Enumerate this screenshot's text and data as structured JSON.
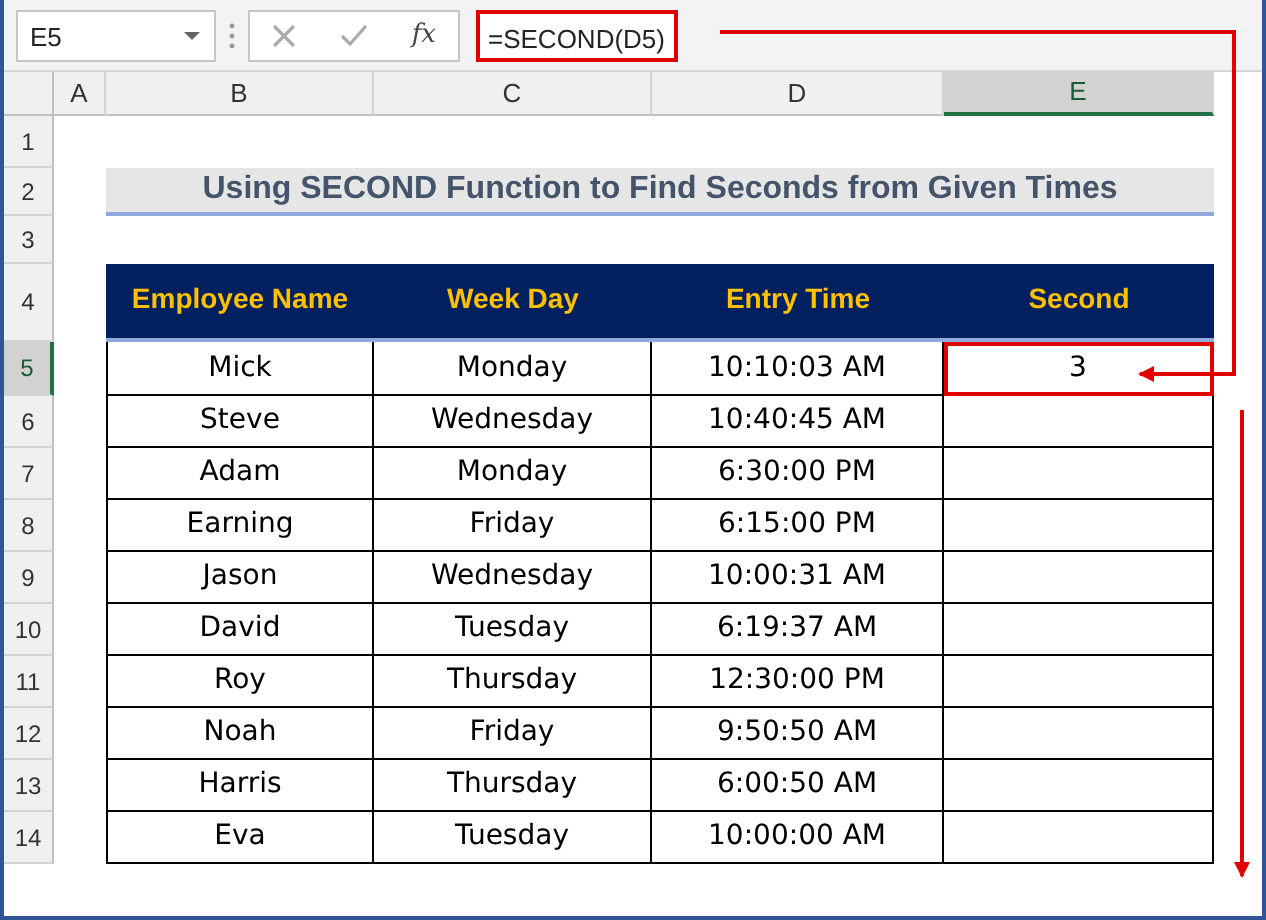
{
  "formula_bar": {
    "name_box": "E5",
    "fx": "fx",
    "formula": "=SECOND(D5)"
  },
  "column_headers": [
    {
      "label": "A",
      "selected": false
    },
    {
      "label": "B",
      "selected": false
    },
    {
      "label": "C",
      "selected": false
    },
    {
      "label": "D",
      "selected": false
    },
    {
      "label": "E",
      "selected": true
    }
  ],
  "row_headers": [
    {
      "label": "1",
      "selected": false
    },
    {
      "label": "2",
      "selected": false
    },
    {
      "label": "3",
      "selected": false
    },
    {
      "label": "4",
      "selected": false
    },
    {
      "label": "5",
      "selected": true
    },
    {
      "label": "6",
      "selected": false
    },
    {
      "label": "7",
      "selected": false
    },
    {
      "label": "8",
      "selected": false
    },
    {
      "label": "9",
      "selected": false
    },
    {
      "label": "10",
      "selected": false
    },
    {
      "label": "11",
      "selected": false
    },
    {
      "label": "12",
      "selected": false
    },
    {
      "label": "13",
      "selected": false
    },
    {
      "label": "14",
      "selected": false
    }
  ],
  "title": "Using SECOND Function to Find Seconds from Given Times",
  "table": {
    "columns": [
      "Employee Name",
      "Week Day",
      "Entry Time",
      "Second"
    ],
    "rows": [
      [
        "Mick",
        "Monday",
        "10:10:03 AM",
        "3"
      ],
      [
        "Steve",
        "Wednesday",
        "10:40:45 AM",
        ""
      ],
      [
        "Adam",
        "Monday",
        "6:30:00 PM",
        ""
      ],
      [
        "Earning",
        "Friday",
        "6:15:00 PM",
        ""
      ],
      [
        "Jason",
        "Wednesday",
        "10:00:31 AM",
        ""
      ],
      [
        "David",
        "Tuesday",
        "6:19:37 AM",
        ""
      ],
      [
        "Roy",
        "Thursday",
        "12:30:00 PM",
        ""
      ],
      [
        "Noah",
        "Friday",
        "9:50:50 AM",
        ""
      ],
      [
        "Harris",
        "Thursday",
        "6:00:50 AM",
        ""
      ],
      [
        "Eva",
        "Tuesday",
        "10:00:00 AM",
        ""
      ]
    ]
  }
}
